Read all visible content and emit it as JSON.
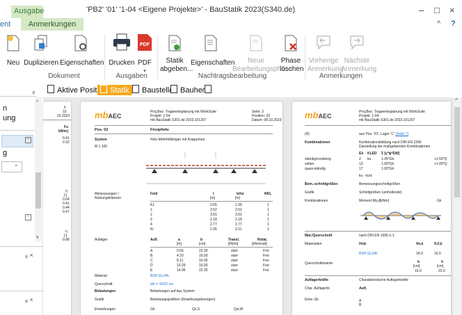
{
  "window": {
    "context_tab": "Ausgabe",
    "title": "'PB2' '01' '1-04 <Eigene Projekte>' - BauStatik 2023(S340.de)",
    "minimize": "–",
    "maximize": "□",
    "close": "×",
    "collapse": "^",
    "help": "?"
  },
  "ribbon_tabs": {
    "partial": "ent",
    "active": "Anmerkungen"
  },
  "ribbon": {
    "neu": "Neu",
    "duplizieren": "Duplizieren",
    "eigenschaften": "Eigenschaften",
    "drucken": "Drucken",
    "pdf": "PDF",
    "statik_abgeben": [
      "Statik",
      "abgeben..."
    ],
    "eigenschaften2": "Eigenschaften",
    "neue_bearbeitungsphase": [
      "Neue",
      "Bearbeitungsphase"
    ],
    "phase_loeschen": [
      "Phase",
      "löschen"
    ],
    "vorherige": [
      "Vorherige",
      "Anmerkung"
    ],
    "naechste": [
      "Nächste",
      "Anmerkung"
    ],
    "groups": {
      "dokument": "Dokument",
      "ausgaben": "Ausgaben",
      "nachtrag": "Nachtragsbearbeitung",
      "anmerkungen": "Anmerkungen"
    }
  },
  "left_panel": {
    "pin": "ᵩ",
    "frag1": "n",
    "frag2": "ung",
    "frag3": "g",
    "close1": "ᵩ ×",
    "close2": "ᵩ ×"
  },
  "doc_tabs": [
    "Aktive Position",
    "Statik",
    "Baustelle",
    "Bauherr"
  ],
  "colors": {
    "accent": "#f6a91e",
    "context": "#d6e9c6",
    "link": "#1a6fd0"
  },
  "page0": {
    "frag": [
      "6",
      "15",
      "10.2023",
      "Fu",
      "kN/m]",
      "0.41",
      "0.32",
      "η",
      "[-]",
      "0.64",
      "0.41",
      "0.44",
      "0.47",
      "η",
      "[-]",
      "0.88"
    ]
  },
  "page1": {
    "logo_mb": "mb",
    "logo_aec": "AEC",
    "header": [
      "Proj.Bez. Tragwerksplanung mit WorkSuite",
      "Projekt: 1-04",
      "mb BauStatik S301.de 2023.101207"
    ],
    "header_r": [
      "Seite: 3",
      "Position: 02",
      "Datum: 08.10.2023"
    ],
    "pos_label": "Pos. 02",
    "pos_title": "Firstpfette",
    "system_label": "System",
    "system_text": "Holz-Mehrfeldträger mit Kragarmen",
    "scale": "M 1:100",
    "abm_label": [
      "Abmessungen /",
      "Nutzungsklassen"
    ],
    "feld_head": [
      "Feld",
      "l",
      "lefor",
      "NKL"
    ],
    "feld_units": [
      "",
      "[m]",
      "[m]",
      ""
    ],
    "feld_rows": [
      [
        "K1",
        "0.65",
        "1.36",
        "1"
      ],
      [
        "1",
        "3.52",
        "3.52",
        "1"
      ],
      [
        "2",
        "3.91",
        "3.91",
        "1"
      ],
      [
        "3",
        "2.18",
        "2.18",
        "1"
      ],
      [
        "4",
        "2.77",
        "2.77",
        "1"
      ],
      [
        "Kr",
        "1.36",
        "3.11",
        "1"
      ]
    ],
    "auflager_label": "Auflager",
    "aufl_head": [
      "Aufl.",
      "a",
      "b",
      "Transl.",
      "Rotat."
    ],
    "aufl_units": [
      "",
      "[m]",
      "[cm]",
      "[kN/m]",
      "[kNm/rad]"
    ],
    "aufl_rows": [
      [
        "A",
        "0.65",
        "22.30",
        "starr",
        "Frei"
      ],
      [
        "B",
        "4.20",
        "16.00",
        "starr",
        "Frei"
      ],
      [
        "C",
        "8.11",
        "16.00",
        "starr",
        "Frei"
      ],
      [
        "D",
        "10.29",
        "16.00",
        "starr",
        "Frei"
      ],
      [
        "E",
        "14.06",
        "22.30",
        "starr",
        "Frei"
      ]
    ],
    "material_label": "Material",
    "material_value": "BSH GL24h",
    "qs_label": "Querschnitt",
    "qs_value": "b/h = 16/22 cm",
    "bel_label": "Belastungen",
    "bel_value": "Belastungen auf das System",
    "grafik_label": "Grafik",
    "grafik_value": "Belastungsgrafiken (Einwirkungsbezogen)",
    "einw_label": "Einwirkungen",
    "einw_vals": [
      "Gk",
      "Qs,S",
      "Qw,W"
    ]
  },
  "page2": {
    "logo_mb": "mb",
    "logo_aec": "AEC",
    "header": [
      "Proj.Bez. Tragwerksplanung mit WorkSuite",
      "Projekt: 1-04",
      "mb BauStatik S301.de 2023.101207"
    ],
    "ref_label": "(R)",
    "ref_value": "aus Pos. '01', Lager 'C'",
    "ref_link": "(Seite 7)",
    "komb_label": "Kombinationen",
    "komb_text": [
      "Kombinationsbildung nach DIN EN 1990",
      "Darstellung der maßgebenden Kombinationen"
    ],
    "komb_head": [
      "Ek",
      "KLED",
      "Σ [γ*ψ*EW]"
    ],
    "komb_rows": [
      [
        "ständig/vorüberg.",
        "2",
        "ku",
        "1.35*Gk",
        "+1.50*Q"
      ],
      [
        "selten",
        "13",
        "",
        "1.00*Gk",
        "+1.00*Q"
      ],
      [
        "quasi-ständig",
        "17",
        "",
        "1.00*Gk",
        ""
      ]
    ],
    "komb_note": "ku : kurz",
    "bem_label": "Bem.-schnittgrößen",
    "bem_value": "Bemessungsschnittgrößen",
    "grafik_label": "Grafik",
    "grafik_value": "Schnittgrößen (umhüllende)",
    "komb2_label": "Kombinationen",
    "komb2_value": "Moment My,d[kNm]",
    "komb2_r": "Gk",
    "mq_label": "Mat./Querschnitt",
    "mq_value": "nach DIN EN 1995-1-1",
    "mat_label": "Materialien",
    "mat_head": [
      "Holz",
      "fm,k",
      "ft,0,k"
    ],
    "mat_row": [
      "BSH GL24h",
      "24.0",
      "16.5"
    ],
    "qsw_label": "Querschnittswerte",
    "qsw_head": [
      "b",
      "h"
    ],
    "qsw_units": [
      "[cm]",
      "[cm]"
    ],
    "qsw_vals": [
      "16.0",
      "22.0"
    ],
    "ak_label": "Auflagerkräfte",
    "ak_value": "Charakteristische Auflagerkräfte",
    "chak_label": "Char. Auflagerkr.",
    "chak_head": "Aufl.",
    "einw_label": "Einw. Gk",
    "einw_rows": [
      "A",
      "B"
    ]
  }
}
